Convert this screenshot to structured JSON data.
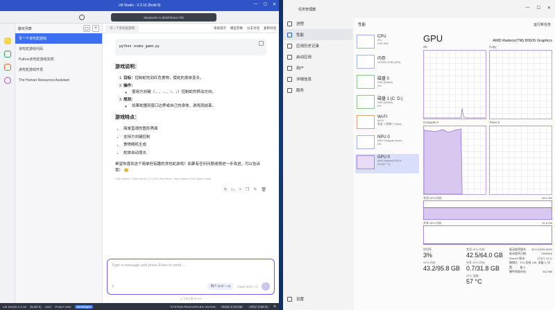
{
  "lm": {
    "title": "LM Studio - 0.3.16 (Build 8)",
    "model": "deepseek-r1-distill-llama-70b",
    "sidebar_title": "聊天列表",
    "chats": [
      {
        "title": "写一个贪吃蛇游戏",
        "time": "26 minutes"
      },
      {
        "title": "贪吃蛇游戏代码",
        "time": "30 hours"
      },
      {
        "title": "Python贪吃蛇游戏实现",
        "time": "30 hours"
      },
      {
        "title": "贪吃蛇游戏开发",
        "time": "30 hours"
      },
      {
        "title": "The Human Resources Assistant",
        "time": "30 hours"
      }
    ],
    "tab": "写一个贪吃蛇游戏",
    "tab_actions": [
      "系统提示",
      "模型参数",
      "分支对话",
      "复制对话"
    ],
    "code": "python snake_game.py",
    "section1": "游戏说明：",
    "ins1_label": "目标：",
    "ins1": "控制蛇吃到红色食物，使蛇的身体变长。",
    "ins2_label": "操作：",
    "ins2_sub": "使用方向键（←、→、↑、↓）控制蛇的移动方向。",
    "ins3_label": "规则：",
    "ins3_sub": "如果蛇撞到窗口边界或自己的身体，游戏就结束。",
    "section2": "游戏特点：",
    "features": [
      "简单直观的图形界面",
      "支持方向键控制",
      "食物随机生成",
      "蛇体自动增长"
    ],
    "closing": "希望你喜欢这个简单但有趣的贪吃蛇游戏！如果有任何问题或想进一步改进，可以告诉我！ 😊",
    "meta": "1.55 tok/sec • 1305 tokens • 17.17s to first token • Stop reason: EOS Token Found",
    "composer_placeholder": "Type a message and press Enter to send ...",
    "composer_chip1": "用户 (Ctrl + U)",
    "composer_chip2": "Insert (Ctrl + I)",
    "context": "上下文占用 61.5%",
    "status_app": "LM Studio 0.3.16",
    "status_build": "(Build 8)",
    "modes": [
      "User",
      "Power User",
      "Developer"
    ],
    "sys_label": "SYSTEM RESOURCES USAGE:",
    "ram": "RAM: 2.73 GB",
    "cpu": "CPU: 0.00 %"
  },
  "tm": {
    "title": "任务管理器",
    "nav": [
      "进程",
      "性能",
      "应用历史记录",
      "启动应用",
      "用户",
      "详细信息",
      "服务"
    ],
    "settings": "设置",
    "perf_header": "性能",
    "run_task": "运行新任务",
    "resources": [
      {
        "name": "CPU",
        "sub1": "3%",
        "sub2": "3.33 GHz"
      },
      {
        "name": "内存",
        "sub1": "14.5/63.4 GB (22%)",
        "sub2": ""
      },
      {
        "name": "磁盘 0",
        "sub1": "SSD (NVMe)",
        "sub2": "0%"
      },
      {
        "name": "磁盘 1 (C: D:)",
        "sub1": "SSD (NVMe)",
        "sub2": "0%"
      },
      {
        "name": "Wi-Fi",
        "sub1": "Wi-Fi",
        "sub2": "发送: 0 接收: 0 Kbps"
      },
      {
        "name": "NPU 0",
        "sub1": "NPU Compute Accel...",
        "sub2": "0%"
      },
      {
        "name": "GPU 0",
        "sub1": "AMD Radeon(TM) 8...",
        "sub2": "3% (57 °C)"
      }
    ],
    "gpu_big": "GPU",
    "gpu_model": "AMD Radeon(TM) 8060S Graphics",
    "g1": "3D",
    "g2": "Copy",
    "g3": "Compute 0",
    "g4": "Timer 0",
    "dedicated_label": "专用 GPU 内存",
    "dedicated_max": "64.0 GB",
    "shared_label": "共享 GPU 内存",
    "shared_max": "31.8 GB",
    "stats": [
      {
        "label": "利用率",
        "value": "3%"
      },
      {
        "label": "专用 GPU 内存",
        "value": "42.5/64.0 GB"
      },
      {
        "label": "GPU 内存",
        "value": "43.2/95.8 GB"
      },
      {
        "label": "共享 GPU 内存",
        "value": "0.7/31.8 GB"
      },
      {
        "label": "GPU 温度",
        "value": "57 °C"
      }
    ],
    "kv": [
      {
        "k": "驱动程序版本:",
        "v": "32.0.21001.9024"
      },
      {
        "k": "驱动程序日期:",
        "v": "2025/6/6"
      },
      {
        "k": "DirectX 版本:",
        "v": "12 (FL 12.1)"
      },
      {
        "k": "物理位置:",
        "v": "PCI 总线 195, 设备 0, 功能 0"
      },
      {
        "k": "硬件保留内存:",
        "v": "512 MB"
      }
    ]
  }
}
